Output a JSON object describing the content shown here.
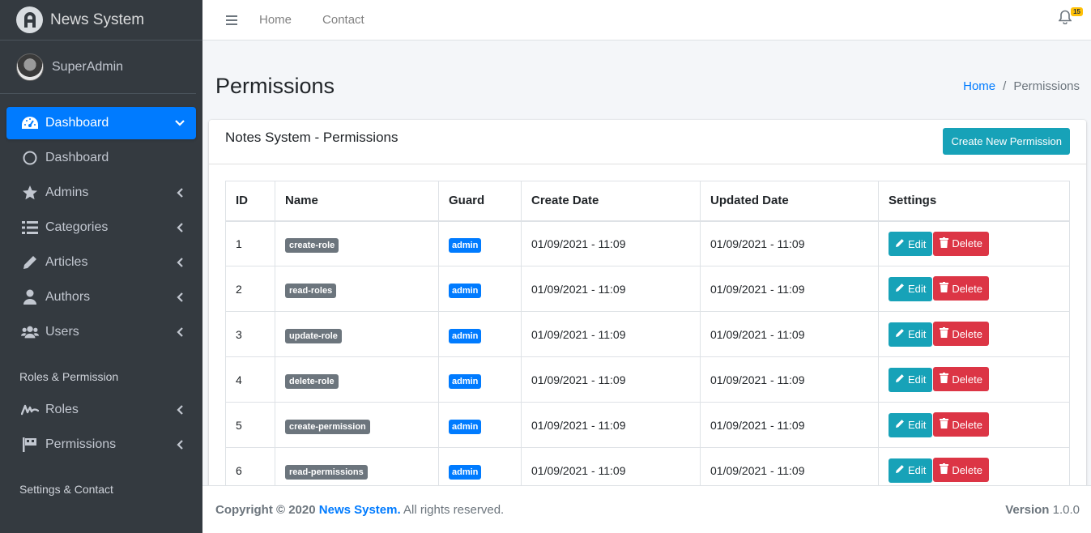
{
  "brand": {
    "name": "News System"
  },
  "user": {
    "name": "SuperAdmin"
  },
  "sidebar": {
    "items": [
      {
        "label": "Dashboard",
        "icon": "tachometer-icon",
        "active": true
      },
      {
        "label": "Dashboard",
        "icon": "circle-icon"
      },
      {
        "label": "Admins",
        "icon": "star-icon"
      },
      {
        "label": "Categories",
        "icon": "list-icon"
      },
      {
        "label": "Articles",
        "icon": "pencil-icon"
      },
      {
        "label": "Authors",
        "icon": "user-icon"
      },
      {
        "label": "Users",
        "icon": "users-icon"
      }
    ],
    "header_roles": "Roles & Permission",
    "roles_items": [
      {
        "label": "Roles",
        "icon": "signature-icon"
      },
      {
        "label": "Permissions",
        "icon": "flag-icon"
      }
    ],
    "header_settings": "Settings & Contact"
  },
  "topbar": {
    "links": [
      "Home",
      "Contact"
    ],
    "notification_count": "15"
  },
  "page": {
    "title": "Permissions",
    "breadcrumb": {
      "home": "Home",
      "sep": "/",
      "current": "Permissions"
    }
  },
  "card": {
    "title": "Notes System - Permissions",
    "create_button": "Create New Permission"
  },
  "table": {
    "headers": [
      "ID",
      "Name",
      "Guard",
      "Create Date",
      "Updated Date",
      "Settings"
    ],
    "edit_label": "Edit",
    "delete_label": "Delete",
    "rows": [
      {
        "id": "1",
        "name": "create-role",
        "guard": "admin",
        "created": "01/09/2021 - 11:09",
        "updated": "01/09/2021 - 11:09"
      },
      {
        "id": "2",
        "name": "read-roles",
        "guard": "admin",
        "created": "01/09/2021 - 11:09",
        "updated": "01/09/2021 - 11:09"
      },
      {
        "id": "3",
        "name": "update-role",
        "guard": "admin",
        "created": "01/09/2021 - 11:09",
        "updated": "01/09/2021 - 11:09"
      },
      {
        "id": "4",
        "name": "delete-role",
        "guard": "admin",
        "created": "01/09/2021 - 11:09",
        "updated": "01/09/2021 - 11:09"
      },
      {
        "id": "5",
        "name": "create-permission",
        "guard": "admin",
        "created": "01/09/2021 - 11:09",
        "updated": "01/09/2021 - 11:09"
      },
      {
        "id": "6",
        "name": "read-permissions",
        "guard": "admin",
        "created": "01/09/2021 - 11:09",
        "updated": "01/09/2021 - 11:09"
      }
    ]
  },
  "footer": {
    "copyright_prefix": "Copyright © 2020",
    "brand_link": "News System.",
    "rights": "All rights reserved.",
    "version_label": "Version",
    "version_value": "1.0.0"
  },
  "colors": {
    "sidebar": "#343a40",
    "primary": "#007bff",
    "info": "#17a2b8",
    "danger": "#dc3545",
    "secondary": "#6c757d",
    "warning": "#ffc107"
  }
}
